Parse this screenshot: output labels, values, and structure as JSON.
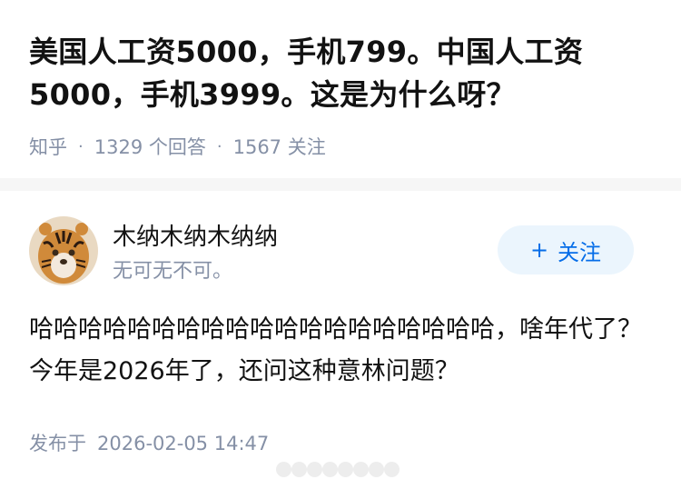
{
  "question": {
    "title": "美国人工资5000，手机799。中国人工资5000，手机3999。这是为什么呀？",
    "source": "知乎",
    "answers_count": "1329 个回答",
    "followers_count": "1567 关注"
  },
  "answer": {
    "author_name": "木纳木纳木纳纳",
    "author_bio": "无可无不可。",
    "follow_label": "关注",
    "follow_icon": "plus-icon",
    "text": "哈哈哈哈哈哈哈哈哈哈哈哈哈哈哈哈哈哈哈，啥年代了？今年是2026年了，还问这种意林问题？",
    "publish_label": "发布于",
    "publish_time": "2026-02-05 14:47",
    "avatar_icon": "tiger-avatar"
  },
  "colors": {
    "title": "#121212",
    "meta": "#8590a6",
    "accent": "#056de8",
    "follow_bg": "#ebf5fd",
    "divider": "#f6f6f6"
  }
}
